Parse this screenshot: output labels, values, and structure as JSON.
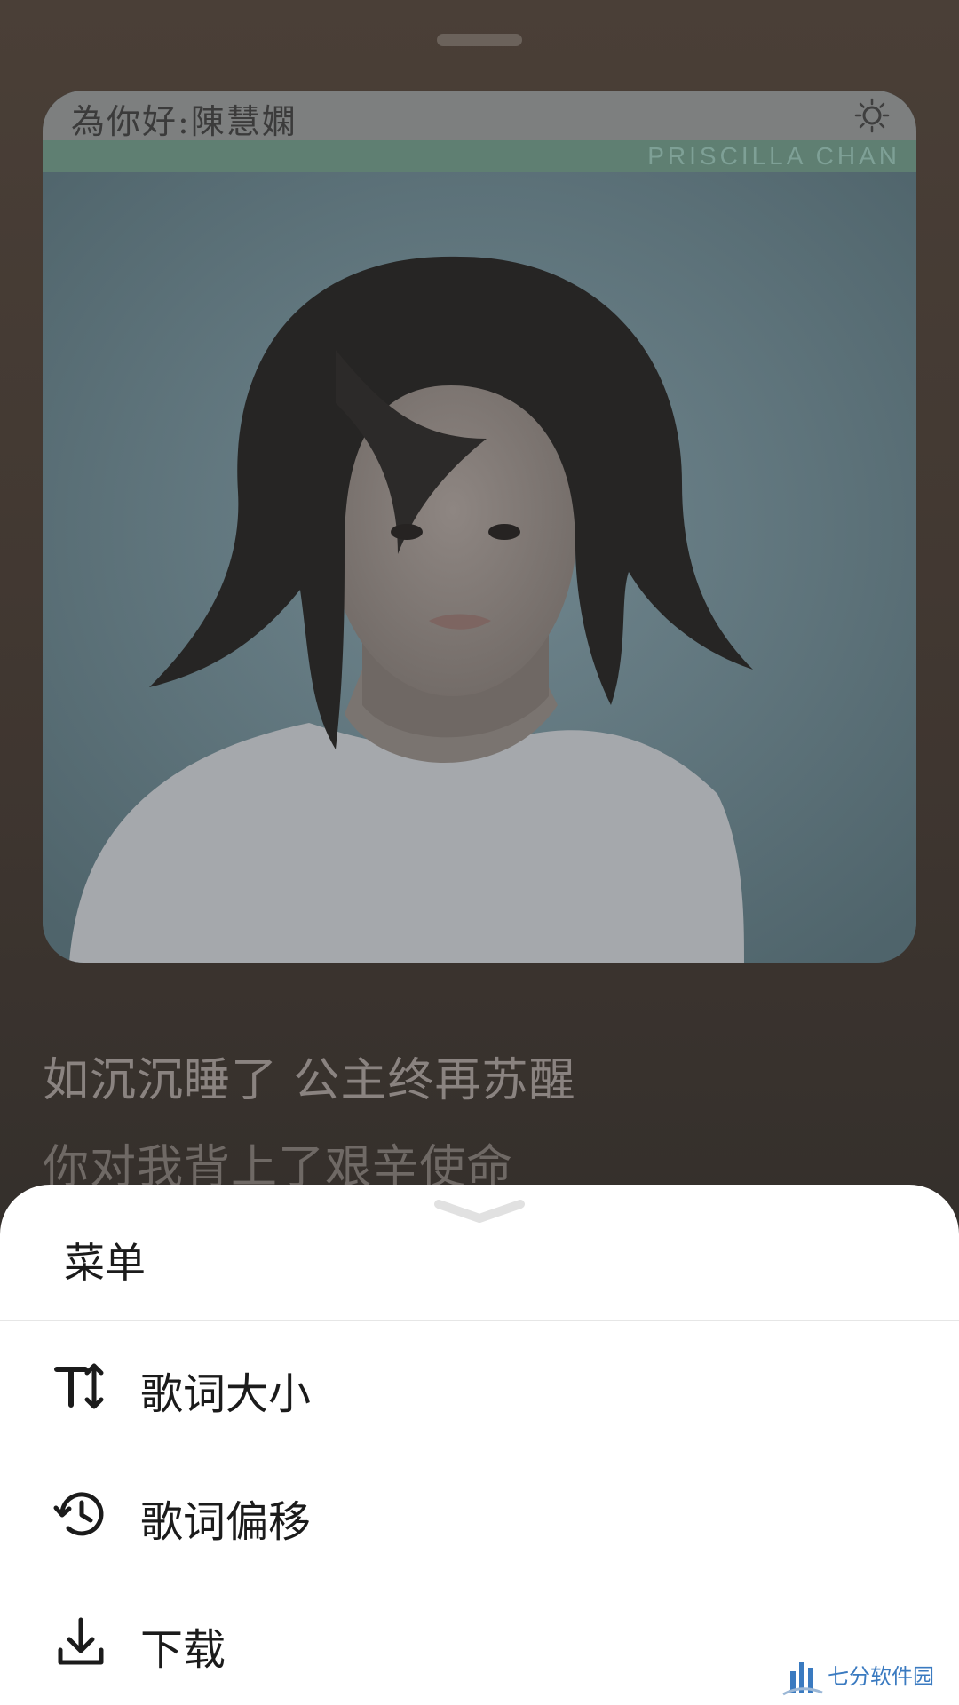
{
  "album": {
    "title": "為你好:陳慧嫻",
    "subtitle": "PRISCILLA CHAN"
  },
  "lyrics": {
    "line1": "如沉沉睡了 公主终再苏醒",
    "line2": "你对我背上了艰辛使命"
  },
  "menu": {
    "title": "菜单",
    "items": [
      {
        "label": "歌词大小",
        "icon": "text-size-icon"
      },
      {
        "label": "歌词偏移",
        "icon": "history-icon"
      },
      {
        "label": "下载",
        "icon": "download-icon"
      }
    ]
  },
  "watermark": {
    "text": "七分软件园"
  },
  "colors": {
    "background": "#3f3630",
    "sheet": "#ffffff",
    "text_primary": "#1b1b1b",
    "lyric_text": "#8a8380"
  }
}
